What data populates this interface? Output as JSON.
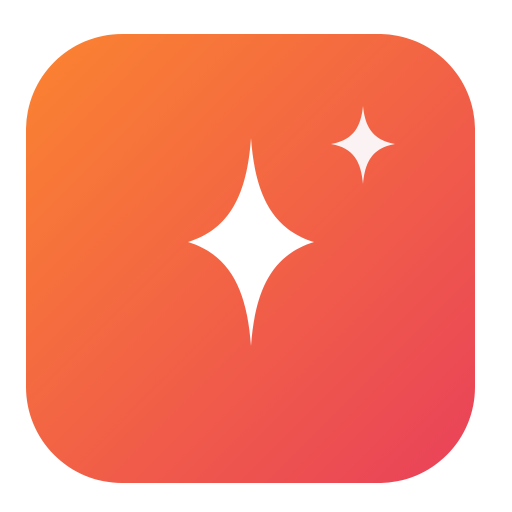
{
  "icon": {
    "name": "sparkles-app-icon",
    "gradient_start": "#FB8430",
    "gradient_end": "#E9415A",
    "glyph_color": "#FFFFFF",
    "small_glyph_color": "#FBF3F3"
  }
}
